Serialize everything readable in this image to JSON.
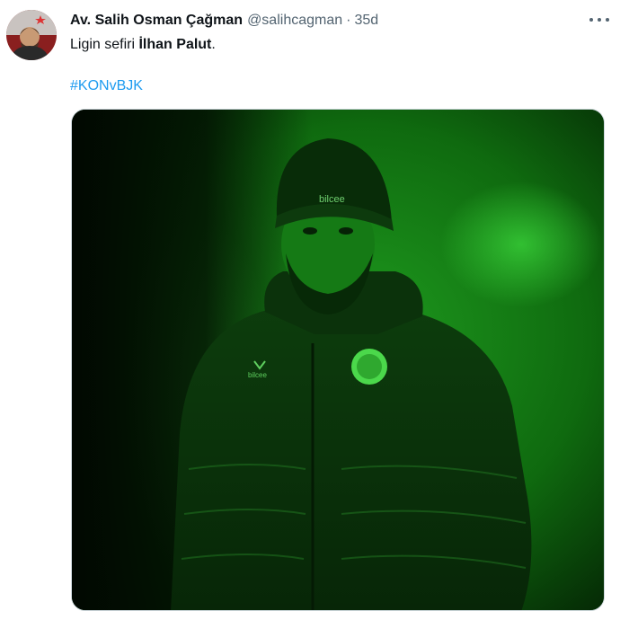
{
  "tweet": {
    "display_name": "Av. Salih Osman Çağman",
    "handle": "@salihcagman",
    "separator": "·",
    "time": "35d",
    "text_prefix": "Ligin sefiri ",
    "text_bold": "İlhan Palut",
    "text_suffix": ".",
    "hashtag": "#KONvBJK",
    "avatar_icon": "user-avatar-photo",
    "more_icon": "more-options-icon",
    "media": {
      "kind": "photo",
      "tint_color": "#1fbf1f",
      "hat_brand": "bilcee",
      "jacket_brand": "bilcee"
    }
  },
  "colors": {
    "link": "#1d9bf0",
    "secondary_text": "#536471",
    "primary_text": "#0f1419"
  }
}
